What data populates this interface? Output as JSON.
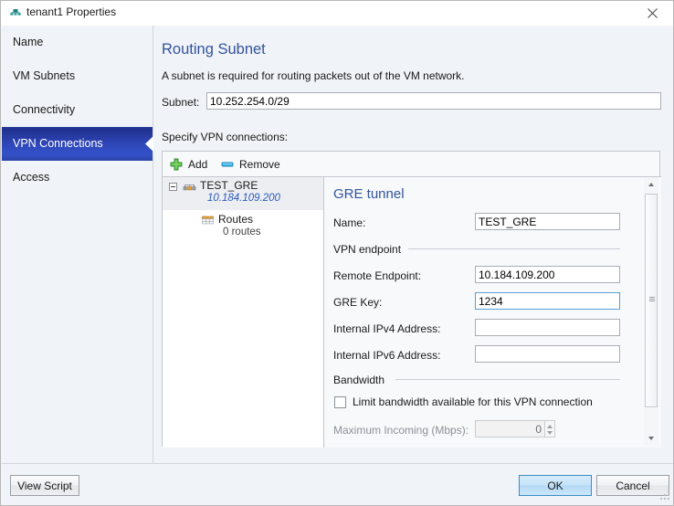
{
  "window": {
    "title": "tenant1 Properties",
    "title_icon": "network-tunnel-icon",
    "close_label": "×"
  },
  "sidebar": {
    "items": [
      {
        "label": "Name",
        "selected": false
      },
      {
        "label": "VM Subnets",
        "selected": false
      },
      {
        "label": "Connectivity",
        "selected": false
      },
      {
        "label": "VPN Connections",
        "selected": true
      },
      {
        "label": "Access",
        "selected": false
      }
    ]
  },
  "main": {
    "title": "Routing Subnet",
    "description": "A subnet is required for routing packets out of the VM network.",
    "subnet_label": "Subnet:",
    "subnet_value": "10.252.254.0/29",
    "subnet_placeholder": "",
    "specify_label": "Specify VPN connections:"
  },
  "toolbar": {
    "add_label": "Add",
    "add_icon": "plus-icon",
    "remove_label": "Remove",
    "remove_icon": "minus-icon"
  },
  "tree": {
    "nodes": [
      {
        "label": "TEST_GRE",
        "sublabel": "10.184.109.200",
        "icon": "vpn-tunnel-icon",
        "expanded": true,
        "selected": true
      },
      {
        "label": "Routes",
        "sublabel": "0 routes",
        "icon": "routes-table-icon",
        "expanded": false,
        "selected": false
      }
    ]
  },
  "detail": {
    "title": "GRE tunnel",
    "name_label": "Name:",
    "name_value": "TEST_GRE",
    "endpoint_group": "VPN endpoint",
    "remote_label": "Remote Endpoint:",
    "remote_value": "10.184.109.200",
    "gre_key_label": "GRE Key:",
    "gre_key_value": "1234",
    "ipv4_label": "Internal IPv4 Address:",
    "ipv4_value": "",
    "ipv6_label": "Internal IPv6 Address:",
    "ipv6_value": "",
    "bandwidth_group": "Bandwidth",
    "limit_checkbox_label": "Limit bandwidth available for this VPN connection",
    "limit_checked": false,
    "max_incoming_label": "Maximum Incoming (Mbps):",
    "max_incoming_value": "0"
  },
  "footer": {
    "view_script_label": "View Script",
    "ok_label": "OK",
    "cancel_label": "Cancel"
  },
  "colors": {
    "accent_heading": "#33539e",
    "selected_nav": "#2f46b8",
    "link_blue": "#2b5bbf",
    "default_button": "#c5e3f8"
  }
}
